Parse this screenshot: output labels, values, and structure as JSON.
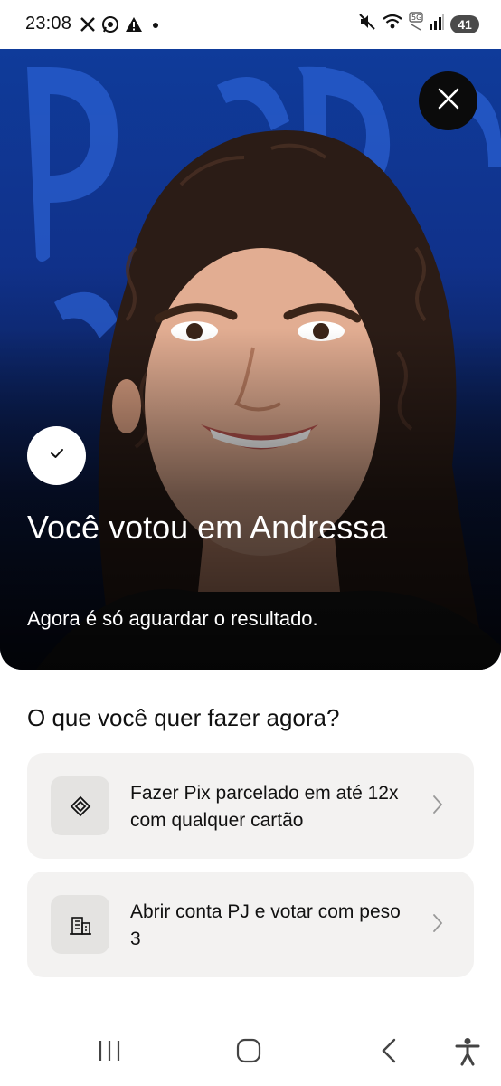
{
  "status_bar": {
    "time": "23:08",
    "left_icons": [
      "x-icon",
      "whatsapp-icon",
      "warning-icon",
      "dot-icon"
    ],
    "right_icons": [
      "mute-icon",
      "wifi-icon",
      "5g-icon",
      "signal-icon"
    ],
    "battery": "41"
  },
  "hero": {
    "title": "Você votou em Andressa",
    "subtitle": "Agora é só aguardar o resultado.",
    "close_icon": "close-icon",
    "check_icon": "checkmark-icon",
    "background_color": "#10318a"
  },
  "sheet": {
    "title": "O que você quer fazer agora?",
    "options": [
      {
        "label": "Fazer Pix parcelado em até 12x com qualquer cartão",
        "icon": "pix-icon"
      },
      {
        "label": "Abrir conta PJ e votar com peso 3",
        "icon": "building-icon"
      }
    ]
  },
  "nav_bar": {
    "buttons": [
      "recents-icon",
      "home-icon",
      "back-icon",
      "accessibility-icon"
    ]
  }
}
